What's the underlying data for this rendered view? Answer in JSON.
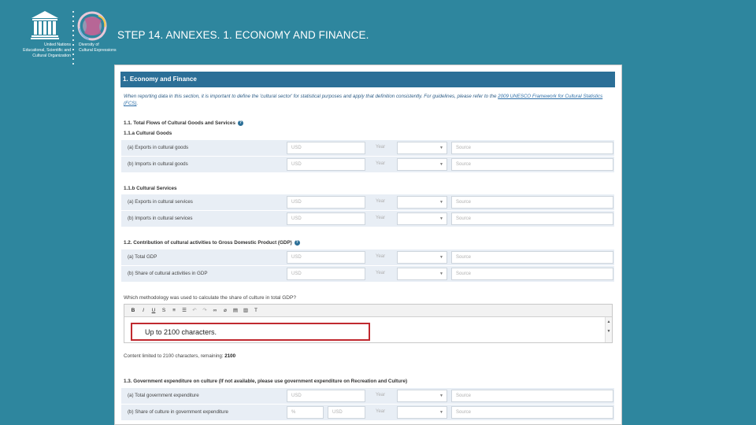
{
  "slide": {
    "title": "STEP 14. ANNEXES. 1. ECONOMY AND FINANCE."
  },
  "logos": {
    "unesco_text": [
      "United Nations",
      "Educational, Scientific and",
      "Cultural Organization"
    ],
    "convention_text": [
      "Diversity of",
      "Cultural Expressions"
    ]
  },
  "form": {
    "header": "1. Economy and Finance",
    "intro_before_link": "When reporting data in this section, it is important to define the 'cultural sector' for statistical purposes and apply that definition consistently. For guidelines, please refer to the ",
    "intro_link": "2009 UNESCO Framework for Cultural Statistics (FCS)",
    "intro_after_link": ".",
    "s1_title": "1.1. Total Flows of Cultural Goods and Services",
    "s1a_title": "1.1.a Cultural Goods",
    "s1b_title": "1.1.b Cultural Services",
    "s2_title": "1.2. Contribution of cultural activities to Gross Domestic Product (GDP)",
    "s3_title": "1.3. Government expenditure on culture (If not available, please use government expenditure on Recreation and Culture)",
    "placeholders": {
      "usd": "USD",
      "year": "Year",
      "source": "Source",
      "percent": "%"
    },
    "rows": {
      "goods_exports": "(a) Exports in cultural goods",
      "goods_imports": "(b) Imports in cultural goods",
      "services_exports": "(a) Exports in cultural services",
      "services_imports": "(b) Imports in cultural services",
      "total_gdp": "(a) Total GDP",
      "share_gdp": "(b) Share of cultural activities in GDP",
      "gov_total": "(a) Total government expenditure",
      "gov_share": "(b) Share of culture in government expenditure"
    },
    "methodology_question": "Which methodology was used to calculate the share of culture in total GDP?",
    "editor_placeholder": "Up to 2100 characters.",
    "limit_text": "Content limited to 2100 characters, remaining: ",
    "limit_remaining": "2100"
  },
  "colors": {
    "background": "#2e869e",
    "header": "#2b6f97",
    "row": "#e8eef5",
    "callout": "#c0292f"
  }
}
